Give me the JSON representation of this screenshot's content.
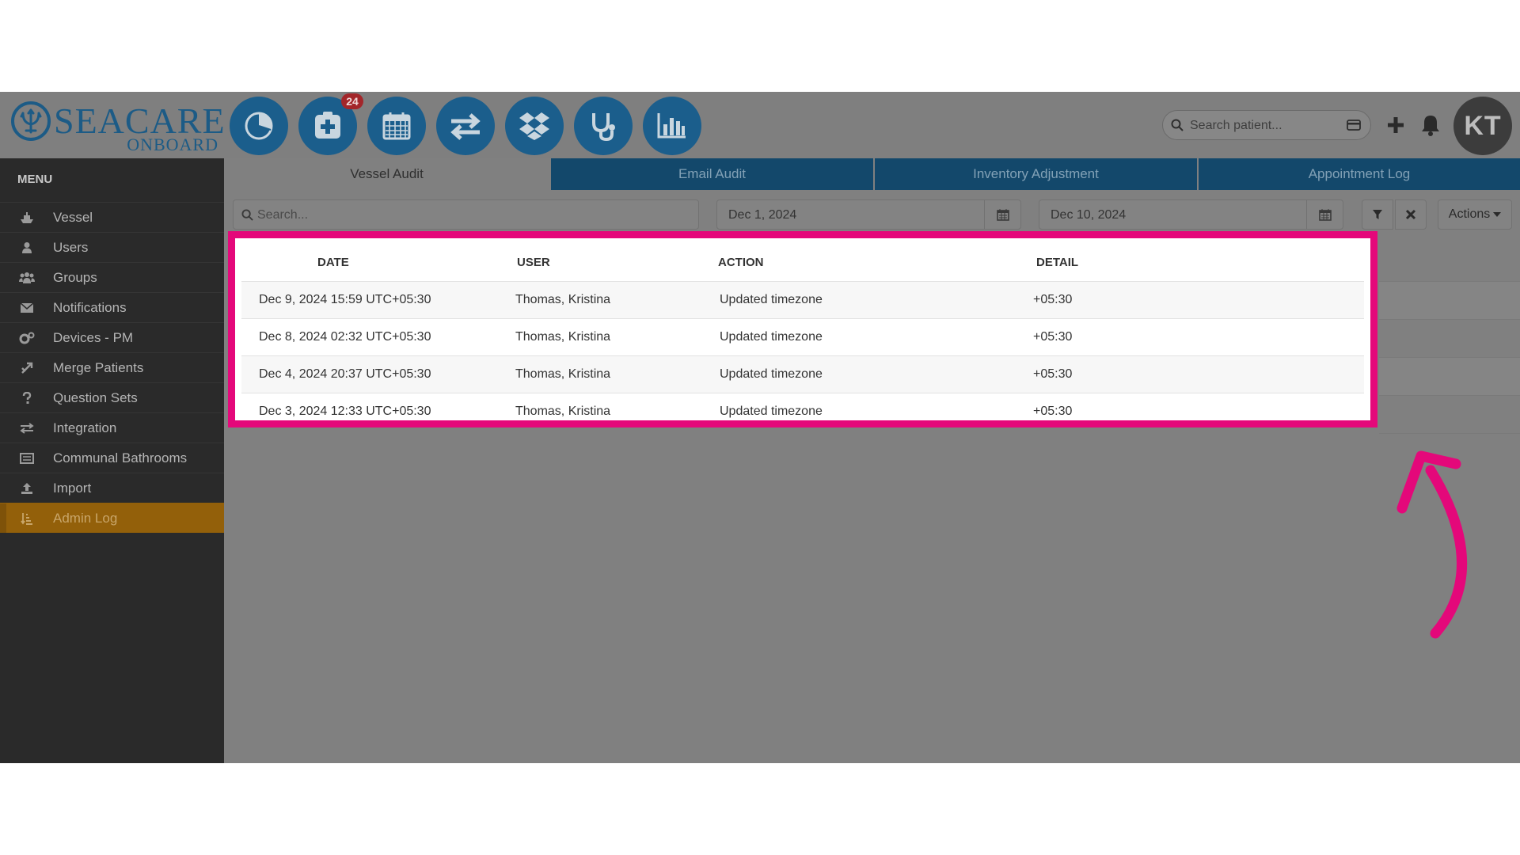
{
  "brand": {
    "name": "SEACARE",
    "sub": "ONBOARD",
    "color": "#1c5b86"
  },
  "quick_actions": [
    {
      "name": "dashboard-pie-icon"
    },
    {
      "name": "medical-plus-icon",
      "badge": "24"
    },
    {
      "name": "calendar-icon"
    },
    {
      "name": "transfer-arrows-icon"
    },
    {
      "name": "dropbox-icon"
    },
    {
      "name": "stethoscope-icon"
    },
    {
      "name": "bar-chart-icon"
    }
  ],
  "header": {
    "search_placeholder": "Search patient...",
    "avatar_initials": "KT"
  },
  "sidebar": {
    "title": "MENU",
    "items": [
      {
        "label": "Vessel",
        "icon": "ship-icon"
      },
      {
        "label": "Users",
        "icon": "user-icon"
      },
      {
        "label": "Groups",
        "icon": "group-icon"
      },
      {
        "label": "Notifications",
        "icon": "envelope-icon"
      },
      {
        "label": "Devices - PM",
        "icon": "gears-icon"
      },
      {
        "label": "Merge Patients",
        "icon": "merge-arrows-icon"
      },
      {
        "label": "Question Sets",
        "icon": "question-icon"
      },
      {
        "label": "Integration",
        "icon": "exchange-icon"
      },
      {
        "label": "Communal Bathrooms",
        "icon": "list-card-icon"
      },
      {
        "label": "Import",
        "icon": "upload-icon"
      },
      {
        "label": "Admin Log",
        "icon": "sort-list-icon",
        "active": true
      }
    ]
  },
  "tabs": [
    {
      "label": "Vessel Audit",
      "active": true
    },
    {
      "label": "Email Audit"
    },
    {
      "label": "Inventory Adjustment"
    },
    {
      "label": "Appointment Log"
    }
  ],
  "filters": {
    "search_placeholder": "Search...",
    "date_from": "Dec 1, 2024",
    "date_to": "Dec 10, 2024",
    "actions_label": "Actions"
  },
  "table": {
    "columns": [
      "DATE",
      "USER",
      "ACTION",
      "DETAIL"
    ],
    "rows": [
      {
        "date": "Dec 9, 2024 15:59 UTC+05:30",
        "user": "Thomas, Kristina",
        "action": "Updated timezone",
        "detail": "+05:30"
      },
      {
        "date": "Dec 8, 2024 02:32 UTC+05:30",
        "user": "Thomas, Kristina",
        "action": "Updated timezone",
        "detail": "+05:30"
      },
      {
        "date": "Dec 4, 2024 20:37 UTC+05:30",
        "user": "Thomas, Kristina",
        "action": "Updated timezone",
        "detail": "+05:30"
      },
      {
        "date": "Dec 3, 2024 12:33 UTC+05:30",
        "user": "Thomas, Kristina",
        "action": "Updated timezone",
        "detail": "+05:30"
      }
    ]
  },
  "annotation": {
    "highlight_color": "#e4087a"
  }
}
